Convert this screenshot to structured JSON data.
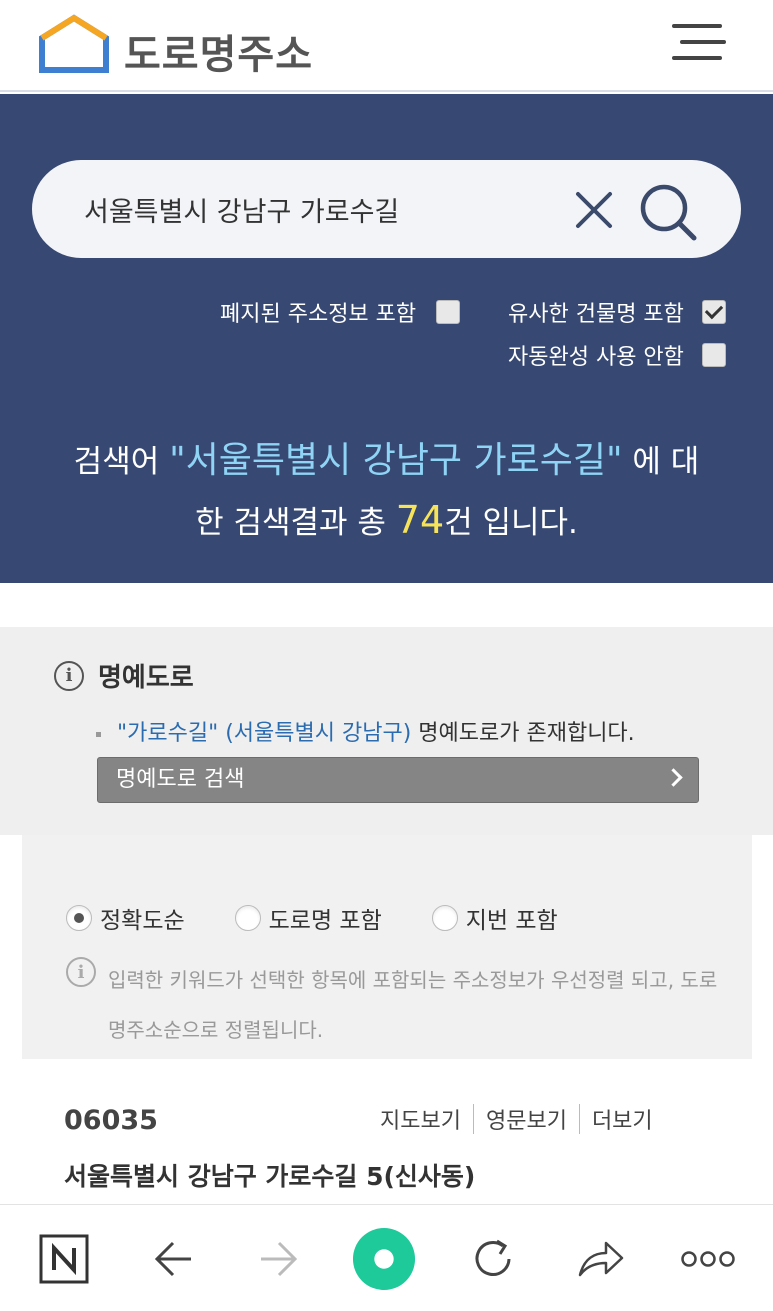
{
  "header": {
    "logo_text": "도로명주소",
    "colors": {
      "logo_orange": "#f5a623",
      "logo_blue": "#3f7fd1"
    }
  },
  "search": {
    "query": "서울특별시 강남구 가로수길",
    "options": [
      {
        "label": "폐지된 주소정보 포함",
        "checked": false
      },
      {
        "label": "유사한 건물명 포함",
        "checked": true
      },
      {
        "label": "자동완성 사용 안함",
        "checked": false
      }
    ],
    "summary": {
      "prefix": "검색어",
      "keyword_quoted": "\"서울특별시 강남구 가로수길\"",
      "mid": "에 대",
      "line2_prefix": "한 검색결과 총",
      "count": "74",
      "suffix": "건 입니다."
    },
    "colors": {
      "panel_bg": "#374872",
      "keyword": "#8fd3f5",
      "count": "#f6e35a"
    }
  },
  "honorary": {
    "title": "명예도로",
    "link_text": "\"가로수길\" (서울특별시 강남구)",
    "rest_text": "명예도로가 존재합니다.",
    "button_label": "명예도로 검색"
  },
  "sort": {
    "options": [
      {
        "label": "정확도순",
        "selected": true
      },
      {
        "label": "도로명 포함",
        "selected": false
      },
      {
        "label": "지번 포함",
        "selected": false
      }
    ],
    "note": "입력한 키워드가 선택한 항목에 포함되는 주소정보가 우선정렬 되고, 도로명주소순으로 정렬됩니다."
  },
  "results": [
    {
      "zip": "06035",
      "address": "서울특별시 강남구 가로수길 5(신사동)",
      "actions": [
        "지도보기",
        "영문보기",
        "더보기"
      ]
    }
  ],
  "browser_bar": {
    "icons": [
      "naver-n-icon",
      "back-arrow-icon",
      "forward-arrow-icon",
      "green-home-icon",
      "reload-icon",
      "share-icon",
      "more-dots-icon"
    ],
    "colors": {
      "green": "#1ec99a"
    }
  }
}
